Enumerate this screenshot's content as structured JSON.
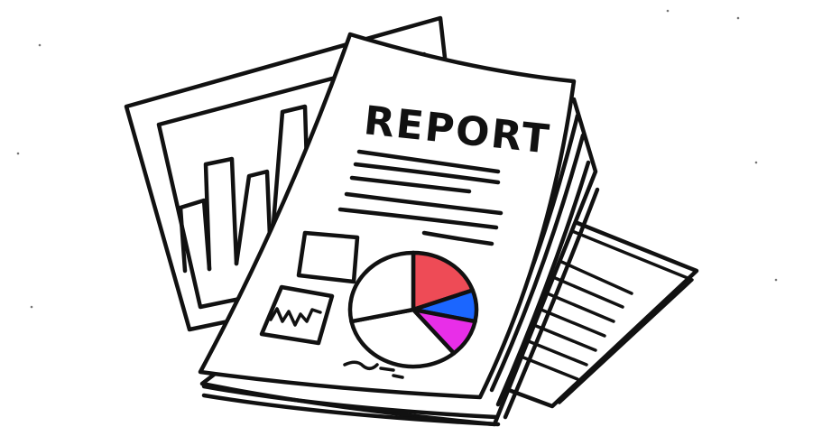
{
  "illustration": {
    "title": "REPORT",
    "pie_chart": {
      "slices": [
        {
          "name": "red",
          "color": "#ee4b56",
          "start": 270,
          "end": 340
        },
        {
          "name": "blue",
          "color": "#1b66ff",
          "start": 340,
          "end": 12
        },
        {
          "name": "magenta",
          "color": "#e82ee8",
          "start": 12,
          "end": 50
        },
        {
          "name": "white-a",
          "color": "#ffffff",
          "start": 50,
          "end": 168
        },
        {
          "name": "white-b",
          "color": "#ffffff",
          "start": 168,
          "end": 270
        }
      ]
    },
    "colors": {
      "ink": "#111111",
      "paper": "#ffffff"
    }
  }
}
